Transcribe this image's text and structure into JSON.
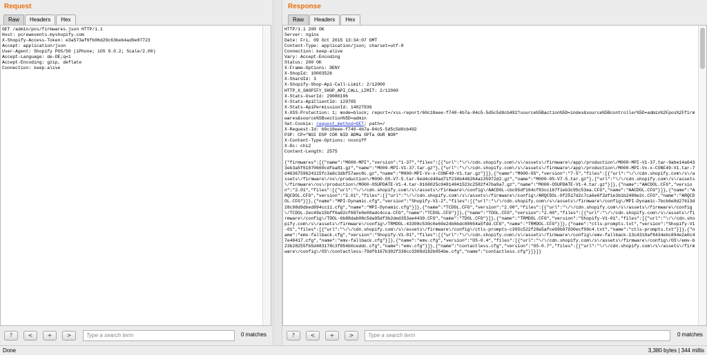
{
  "request": {
    "title": "Request",
    "tabs": [
      "Raw",
      "Headers",
      "Hex"
    ],
    "lines": [
      "GET /admin/pos/firmwares.json HTTP/1.1",
      "Host: pcrewevents.myshopify.com",
      "X-Shopify-Access-Token: e3a573af6fb06d29c63beb4ad9e87723",
      "Accept: application/json",
      "User-Agent: Shopify POS/50 (iPhone; iOS 9.0.2; Scale/2.00)",
      "Accept-Language: de-DE;q=1",
      "Accept-Encoding: gzip, deflate",
      "Connection: keep-alive"
    ],
    "search": {
      "prev": "?",
      "back": "<",
      "plus": "+",
      "next": ">",
      "placeholder": "Type a search term",
      "matches": "0 matches"
    }
  },
  "response": {
    "title": "Response",
    "tabs": [
      "Raw",
      "Headers",
      "Hex"
    ],
    "lines": [
      "HTTP/1.1 200 OK",
      "Server: nginx",
      "Date: Fri, 09 Oct 2015 13:34:07 GMT",
      "Content-Type: application/json; charset=utf-8",
      "Connection: keep-alive",
      "Vary: Accept-Encoding",
      "Status: 200 OK",
      "X-Frame-Options: DENY",
      "X-ShopId: 10003526",
      "X-ShardId: 3",
      "X-Shopify-Shop-Api-Call-Limit: 2/12000",
      "HTTP_X_SHOPIFY_SHOP_API_CALL_LIMIT: 2/12000",
      "X-Stats-UserId: 29080196",
      "X-Stats-ApiClientId: 129785",
      "X-Stats-ApiPermissionId: 14027936",
      "X-XSS-Protection: 1; mode=block; report=/xss-report/60c18eee-f740-4b7a-84c5-5d5c5d0cb492?source%5Baction%5D=index&source%5Bcontroller%5D=admin%2Fpos%2Ffirmwares&source%5Bsection%5D=admin",
      "Set-Cookie: request_method=GET; path=/",
      "X-Request-Id: 60c18eee-f740-4b7a-84c5-5d5c5d0cb492",
      "P3P: CP=\"NOI DSP COR NID ADMa OPTa OUR NOR\"",
      "X-Content-Type-Options: nosniff",
      "X-Dc: chi2",
      "Content-Length: 2575",
      "",
      "{\"firmwares\":[{\"name\":\"M000-MPI\",\"version\":\"1-37\",\"files\":[{\"url\":\"\\/\\/cdn.shopify.com\\/s\\/assets\\/firmware\\/app\\/production\\/M000-MPI-V1-37.tar-9abe14a6433eb3a5f61870660cdfea81.gz\",\"name\":\"M000-MPI-V1-37.tar.gz\"},{\"url\":\"\\/\\/cdn.shopify.com\\/s\\/assets\\/firmware\\/app\\/production\\/M000-MPI-Vx-x-CONF49-V1.tar-7d4636759624115fc3a6c3dbf57aec8c.gz\",\"name\":\"M000-MPI-Vx-x-CONF49-V1.tar.gz\"}]},{\"name\":\"M000-OS\",\"version\":\"7-5\",\"files\":[{\"url\":\"\\/\\/cdn.shopify.com\\/s\\/assets\\/firmware\\/os\\/production\\/M000-OS-V7-5.tar-9ed4cd40ad71f234b446264a135972d2.gz\",\"name\":\"M000-OS-V7-5.tar.gz\"},{\"url\":\"\\/\\/cdn.shopify.com\\/s\\/assets\\/firmware\\/os\\/production\\/M000-OSUPDATE-V1-4.tar-9168025c94814041523c2582f47ba9a7.gz\",\"name\":\"M000-OSUPDATE-V1-4.tar.gz\"}]},{\"name\":\"AACDOL.CFG\",\"version\":\"2.01\",\"files\":[{\"url\":\"\\/\\/cdn.shopify.com\\/s\\/assets\\/firmware\\/config\\/AACDOL-cbc95df164cf83cc167f1eb3c95c53ea.CFG\",\"name\":\"AACDOL.CFG\"}]},{\"name\":\"ARQCDOL.CFG\",\"version\":\"2.01\",\"files\":[{\"url\":\"\\/\\/cdn.shopify.com\\/s\\/assets\\/firmware\\/config\\/ARQCDOL-0f2517d2c7ca6e6f2df1e3b1b2486e2c.CFG\",\"name\":\"ARQCDOL.CFG\"}]},{\"name\":\"MPI-Dynamic.cfg\",\"version\":\"Shopify-V1-2\",\"files\":[{\"url\":\"\\/\\/cdn.shopify.com\\/s\\/assets\\/firmware\\/config\\/MPI-Dynamic-7bcb6e8d27613d28c98d9dbed994cc11.cfg\",\"name\":\"MPI-Dynamic.cfg\"}]},{\"name\":\"TCDOL.CFG\",\"version\":\"2.00\",\"files\":[{\"url\":\"\\/\\/cdn.shopify.com\\/s\\/assets\\/firmware\\/config\\/TCDOL-2ec49e15bff6a82cf687e0e00adc4cca.CFG\",\"name\":\"TCDOL.CFG\"}]},{\"name\":\"TDOL.CFG\",\"version\":\"2.00\",\"files\":[{\"url\":\"\\/\\/cdn.shopify.com\\/s\\/assets\\/firmware\\/config\\/TDOL-6b88dab08c5da95df3b2ded353ae4439.CFG\",\"name\":\"TDOL.CFG\"}]},{\"name\":\"TRMDOL.CFG\",\"version\":\"Shopify-V1-01\",\"files\":[{\"url\":\"\\/\\/cdn.shopify.com\\/s\\/assets\\/firmware\\/config\\/TRMDOL-43308c530c0e60e24b6bdc88654a5fdd.CFG\",\"name\":\"TRMDOL.CFG\"}]},{\"name\":\"ctls-prompts.txt\",\"version\":\"Shopify-V1-01\",\"files\":[{\"url\":\"\\/\\/cdn.shopify.com\\/s\\/assets\\/firmware\\/config\\/ctls-prompts-c395c522f28a5afce99b87930ecf09c4.txt\",\"name\":\"ctls-prompts.txt\"}]},{\"name\":\"emv-fallback.cfg\",\"version\":\"Shopify-V1-01\",\"files\":[{\"url\":\"\\/\\/cdn.shopify.com\\/s\\/assets\\/firmware\\/config\\/emv-fallback-13c4319af8434ebc894e2a0c47e48417.cfg\",\"name\":\"emv-fallback.cfg\"}]},{\"name\":\"emv.cfg\",\"version\":\"OS-0.4\",\"files\":[{\"url\":\"\\/\\/cdn.shopify.com\\/s\\/assets\\/firmware\\/config\\/OS\\/emv-b23b28255fb5d483178c3f854b0ceddc.cfg\",\"name\":\"emv.cfg\"}]},{\"name\":\"contactless.cfg\",\"version\":\"OS-0.7\",\"files\":[{\"url\":\"\\/\\/cdn.shopify.com\\/s\\/assets\\/firmware\\/config\\/OS\\/contactless-79dfb167b302f336cc3308d182b054be.cfg\",\"name\":\"contactless.cfg\"}]}]}"
    ],
    "cookie_prefix": "Set-Cookie: ",
    "cookie_link": "request_method=GET",
    "cookie_suffix": "; path=/",
    "search": {
      "prev": "?",
      "back": "<",
      "plus": "+",
      "next": ">",
      "placeholder": "Type a search term",
      "matches": "0 matches"
    }
  },
  "status": {
    "left": "Done",
    "right": "3,380 bytes | 344 millis"
  }
}
